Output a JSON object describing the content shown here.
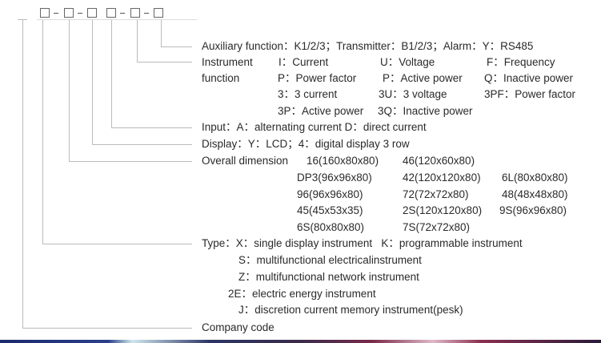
{
  "code_pattern": {
    "groups": 3,
    "description": "model code boxes"
  },
  "aux": "Auxiliary function：K1/2/3；Transmitter：B1/2/3；Alarm：Y：RS485",
  "instrument": {
    "label1": "Instrument",
    "label2": "function",
    "rows": [
      [
        "I：Current",
        "U：Voltage",
        "F：Frequency"
      ],
      [
        "P：Power factor",
        "P：Active power",
        "Q：Inactive power"
      ],
      [
        "3：3 current",
        "3U：3 voltage",
        "3PF：Power factor"
      ],
      [
        "3P：Active power",
        "3Q：Inactive power"
      ]
    ]
  },
  "input": "Input：A：alternating current D：direct current",
  "display": "Display：Y：LCD；4：digital display 3 row",
  "dimension": {
    "label": "Overall dimension",
    "rows": [
      [
        "16(160x80x80)",
        "46(120x60x80)"
      ],
      [
        "DP3(96x96x80)",
        "42(120x120x80)",
        "6L(80x80x80)"
      ],
      [
        "96(96x96x80)",
        "72(72x72x80)",
        "48(48x48x80)"
      ],
      [
        "45(45x53x35)",
        "2S(120x120x80)",
        "9S(96x96x80)"
      ],
      [
        "6S(80x80x80)",
        "7S(72x72x80)"
      ]
    ]
  },
  "type": {
    "first": "Type：X：single display instrument   K：programmable instrument",
    "rows": [
      "S：multifunctional electricalinstrument",
      "Z：multifunctional network instrument",
      "2E：electric energy instrument",
      "J：discretion current memory instrument(pesk)"
    ]
  },
  "company": "Company code"
}
